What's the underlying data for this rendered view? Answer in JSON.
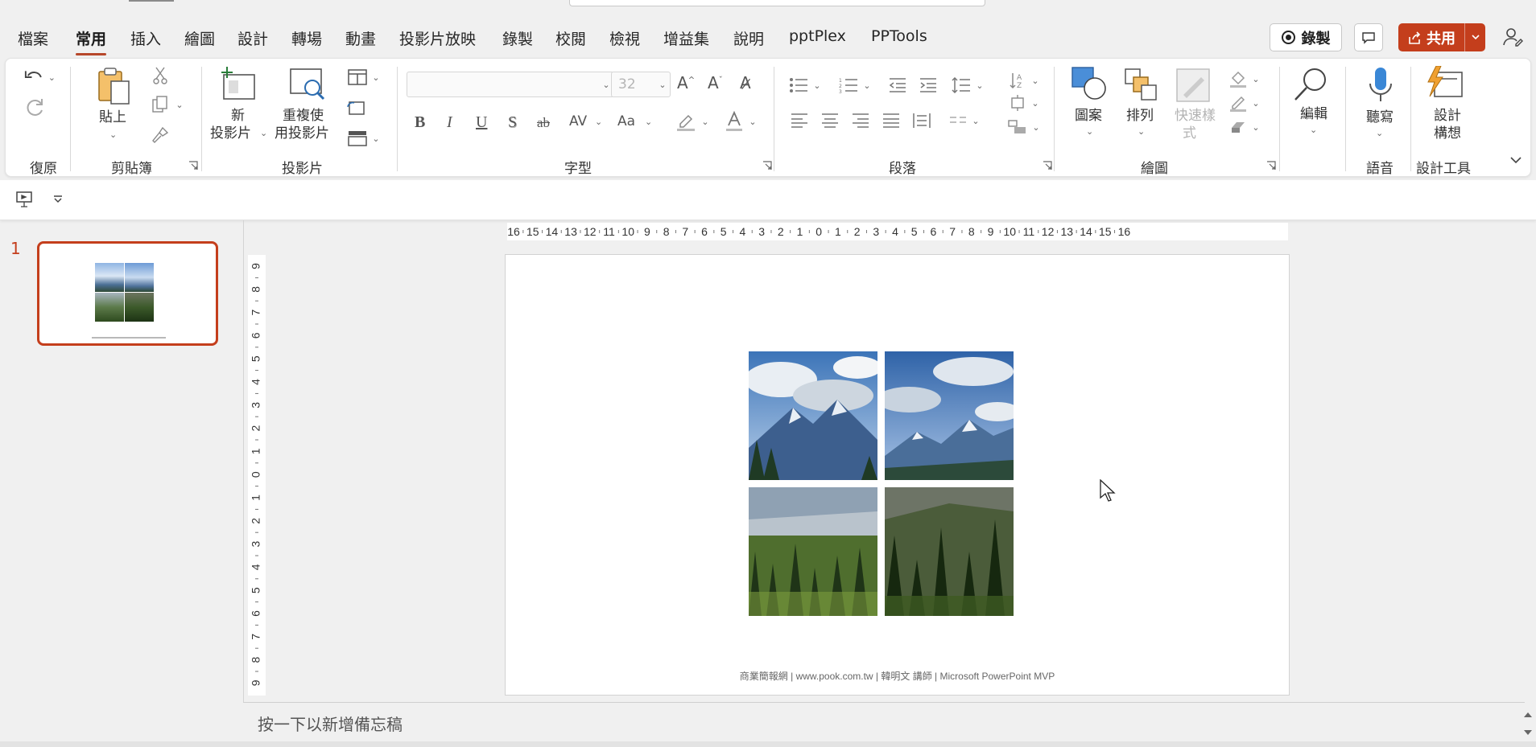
{
  "menu": {
    "tabs": [
      "檔案",
      "常用",
      "插入",
      "繪圖",
      "設計",
      "轉場",
      "動畫",
      "投影片放映",
      "錄製",
      "校閱",
      "檢視",
      "增益集",
      "說明",
      "pptPlex",
      "PPTools"
    ],
    "active_tab": "常用",
    "record_label": "錄製",
    "share_label": "共用"
  },
  "ribbon": {
    "groups": {
      "undo": "復原",
      "clipboard": "剪貼簿",
      "slides": "投影片",
      "font": "字型",
      "paragraph": "段落",
      "drawing": "繪圖",
      "voice": "語音",
      "designer": "設計工具"
    },
    "buttons": {
      "paste": "貼上",
      "new_slide_1": "新",
      "new_slide_2": "投影片",
      "reuse_1": "重複使",
      "reuse_2": "用投影片",
      "shapes": "圖案",
      "arrange": "排列",
      "quick_styles_1": "快速樣",
      "quick_styles_2": "式",
      "editing": "編輯",
      "dictate": "聽寫",
      "design_ideas_1": "設計",
      "design_ideas_2": "構想"
    },
    "font_name": "",
    "font_size": "32",
    "format_buttons": [
      "B",
      "I",
      "U",
      "S",
      "ab",
      "AV",
      "Aa"
    ]
  },
  "thumbnail": {
    "number": "1"
  },
  "rulers": {
    "horizontal": [
      "16",
      "15",
      "14",
      "13",
      "12",
      "11",
      "10",
      "9",
      "8",
      "7",
      "6",
      "5",
      "4",
      "3",
      "2",
      "1",
      "0",
      "1",
      "2",
      "3",
      "4",
      "5",
      "6",
      "7",
      "8",
      "9",
      "10",
      "11",
      "12",
      "13",
      "14",
      "15",
      "16"
    ],
    "vertical": [
      "9",
      "8",
      "7",
      "6",
      "5",
      "4",
      "3",
      "2",
      "1",
      "0",
      "1",
      "2",
      "3",
      "4",
      "5",
      "6",
      "7",
      "8",
      "9"
    ]
  },
  "slide": {
    "footer": "商業簡報網 | www.pook.com.tw | 韓明文 講師 | Microsoft PowerPoint MVP",
    "photos": [
      "clouds-mountain-left",
      "clouds-mountain-right",
      "forest-valley-left",
      "forest-hill-right"
    ]
  },
  "notes": {
    "placeholder": "按一下以新增備忘稿"
  },
  "colors": {
    "accent": "#c43e1c",
    "share": "#c43e1c"
  }
}
